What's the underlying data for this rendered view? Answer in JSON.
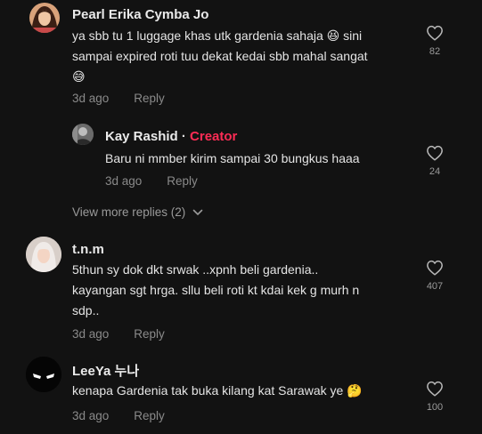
{
  "comments": [
    {
      "username": "Pearl Erika Cymba Jo",
      "text_line1": "ya sbb tu 1 luggage khas utk gardenia sahaja 😆 sini",
      "text_line2": "sampai expired roti tuu dekat kedai sbb mahal sangat",
      "text_line3": "😅",
      "time": "3d ago",
      "reply_label": "Reply",
      "likes": "82"
    },
    {
      "username": "Kay Rashid",
      "separator": "·",
      "badge": "Creator",
      "text_line1": "Baru ni mmber kirim sampai 30 bungkus haaa",
      "time": "3d ago",
      "reply_label": "Reply",
      "likes": "24"
    },
    {
      "username": "t.n.m",
      "text_line1": "5thun sy dok dkt srwak ..xpnh beli gardenia..",
      "text_line2": "kayangan sgt hrga. sllu beli roti kt kdai kek g murh n",
      "text_line3": "sdp..",
      "time": "3d ago",
      "reply_label": "Reply",
      "likes": "407"
    },
    {
      "username": "LeeYa 누나",
      "text_line1": "kenapa Gardenia tak buka kilang kat Sarawak ye 🤔",
      "time": "3d ago",
      "reply_label": "Reply",
      "likes": "100"
    }
  ],
  "view_more_replies": "View more replies (2)",
  "icons": {
    "heart": "heart-outline-icon",
    "chevron": "chevron-down-icon"
  },
  "colors": {
    "background": "#121212",
    "creator": "#fe2c55",
    "meta": "#8a8a8a"
  }
}
